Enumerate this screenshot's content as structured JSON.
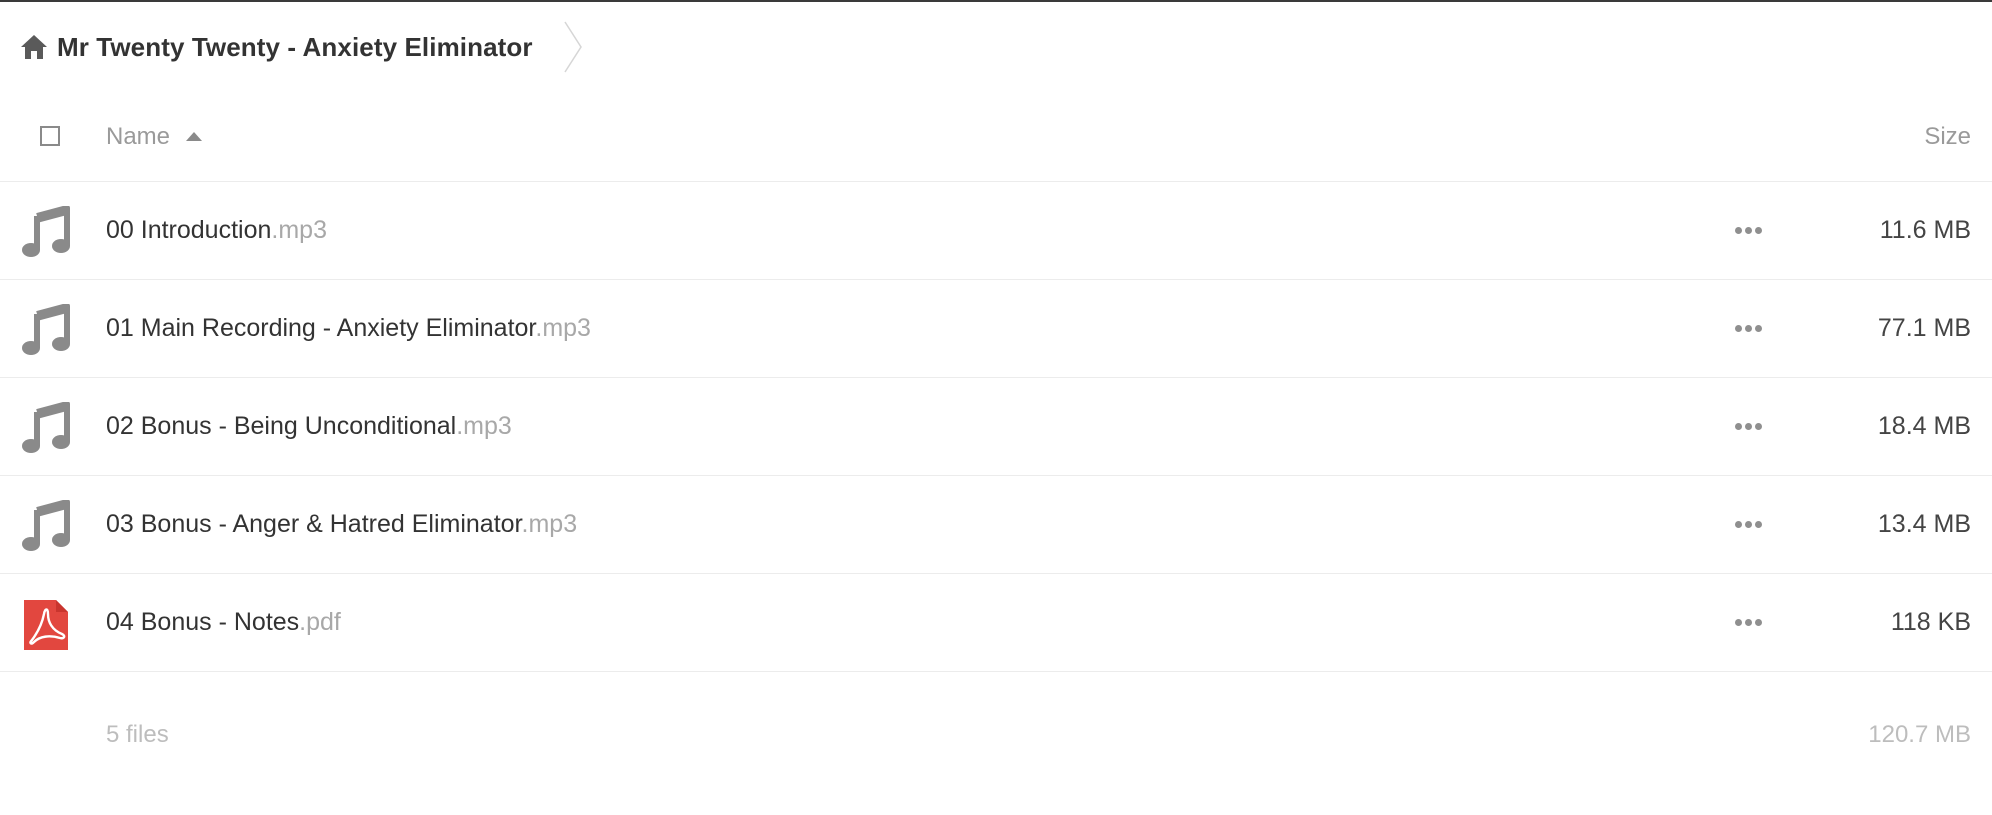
{
  "breadcrumb": {
    "home_icon": "home-icon",
    "folder_name": "Mr Twenty Twenty - Anxiety Eliminator"
  },
  "table_header": {
    "name_label": "Name",
    "size_label": "Size",
    "sort_direction": "ascending"
  },
  "files": [
    {
      "base": "00 Introduction",
      "ext": ".mp3",
      "size": "11.6 MB",
      "icon": "music-note-icon"
    },
    {
      "base": "01 Main Recording - Anxiety Eliminator",
      "ext": ".mp3",
      "size": "77.1 MB",
      "icon": "music-note-icon"
    },
    {
      "base": "02 Bonus - Being Unconditional",
      "ext": ".mp3",
      "size": "18.4 MB",
      "icon": "music-note-icon"
    },
    {
      "base": "03 Bonus - Anger & Hatred Eliminator",
      "ext": ".mp3",
      "size": "13.4 MB",
      "icon": "music-note-icon"
    },
    {
      "base": "04 Bonus - Notes",
      "ext": ".pdf",
      "size": "118 KB",
      "icon": "pdf-icon"
    }
  ],
  "summary": {
    "count": "5 files",
    "total_size": "120.7 MB"
  },
  "colors": {
    "icon_gray": "#8a8a8a",
    "pdf_red": "#e2473f",
    "text_dark": "#333333",
    "text_muted": "#a8a8a8"
  }
}
